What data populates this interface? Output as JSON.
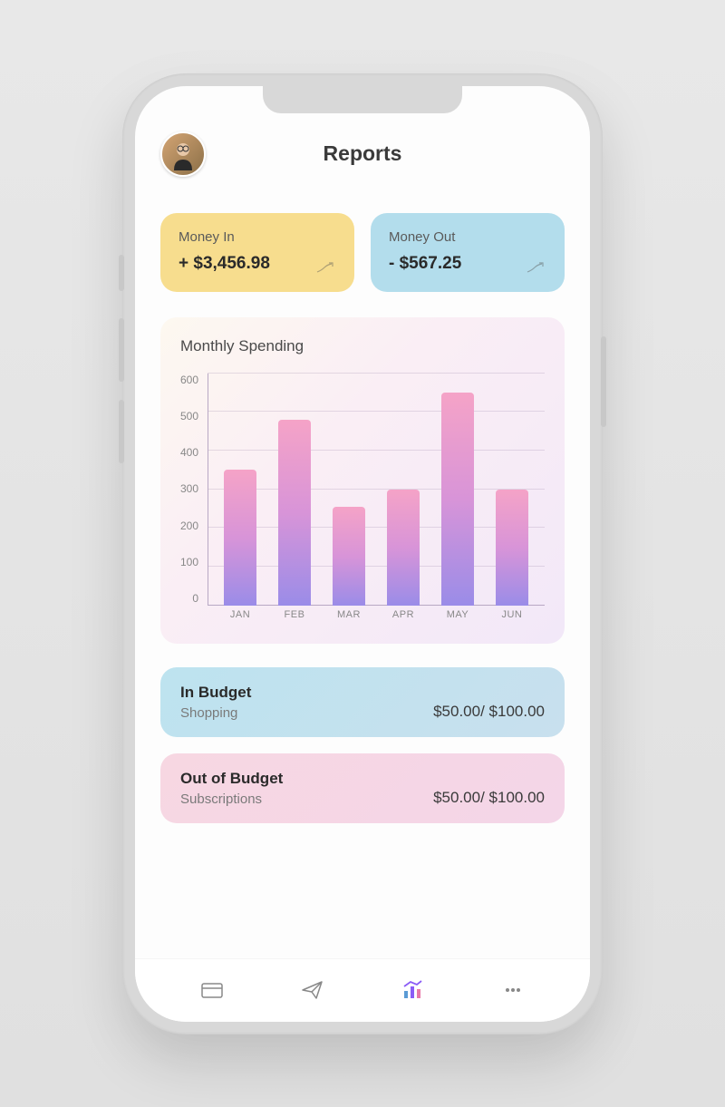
{
  "header": {
    "title": "Reports"
  },
  "stats": {
    "money_in": {
      "label": "Money In",
      "value": "+ $3,456.98"
    },
    "money_out": {
      "label": "Money Out",
      "value": "- $567.25"
    }
  },
  "chart_data": {
    "type": "bar",
    "title": "Monthly Spending",
    "categories": [
      "JAN",
      "FEB",
      "MAR",
      "APR",
      "MAY",
      "JUN"
    ],
    "values": [
      350,
      480,
      255,
      300,
      550,
      300
    ],
    "ylabel": "",
    "xlabel": "",
    "ylim": [
      0,
      600
    ],
    "yticks": [
      0,
      100,
      200,
      300,
      400,
      500,
      600
    ]
  },
  "budgets": {
    "in_budget": {
      "title": "In Budget",
      "category": "Shopping",
      "amount": "$50.00/ $100.00"
    },
    "out_budget": {
      "title": "Out of Budget",
      "category": "Subscriptions",
      "amount": "$50.00/ $100.00"
    }
  },
  "colors": {
    "card_yellow": "#f7dd8e",
    "card_blue": "#b3ddec",
    "card_pink": "#f7d7e2",
    "bar_top": "#f5a3c7",
    "bar_bottom": "#9a8ce8",
    "active_nav": "#8b5cf6"
  }
}
